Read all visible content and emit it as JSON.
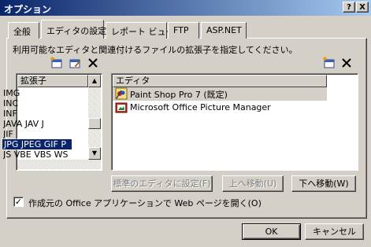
{
  "window": {
    "title": "オプション",
    "help_label": "?",
    "close_label": "X"
  },
  "tabs": [
    {
      "label": "全般"
    },
    {
      "label": "エディタの設定"
    },
    {
      "label": "レポート ビュー"
    },
    {
      "label": "FTP"
    },
    {
      "label": "ASP.NET"
    }
  ],
  "editor_settings": {
    "description": "利用可能なエディタと関連付けるファイルの拡張子を指定してください。",
    "extensions_header": "拡張子",
    "extensions": [
      "IMG",
      "INC",
      "INF",
      "JAVA JAV J",
      "JIF",
      "JPG JPEG GIF P",
      "JS VBE VBS WS"
    ],
    "selected_extension_index": 5,
    "editors_header": "エディタ",
    "editors": [
      {
        "name": "Paint Shop Pro 7 (既定)",
        "icon": "paint-shop-pro-icon"
      },
      {
        "name": "Microsoft Office Picture Manager",
        "icon": "picture-manager-icon"
      }
    ],
    "set_default_label": "標準のエディタに設定(F)",
    "move_up_label": "上へ移動(U)",
    "move_down_label": "下へ移動(W)",
    "checkbox_label": "作成元の Office アプリケーションで Web ページを開く(O)",
    "checkbox_checked": true
  },
  "footer": {
    "ok_label": "OK",
    "cancel_label": "キャンセル"
  }
}
